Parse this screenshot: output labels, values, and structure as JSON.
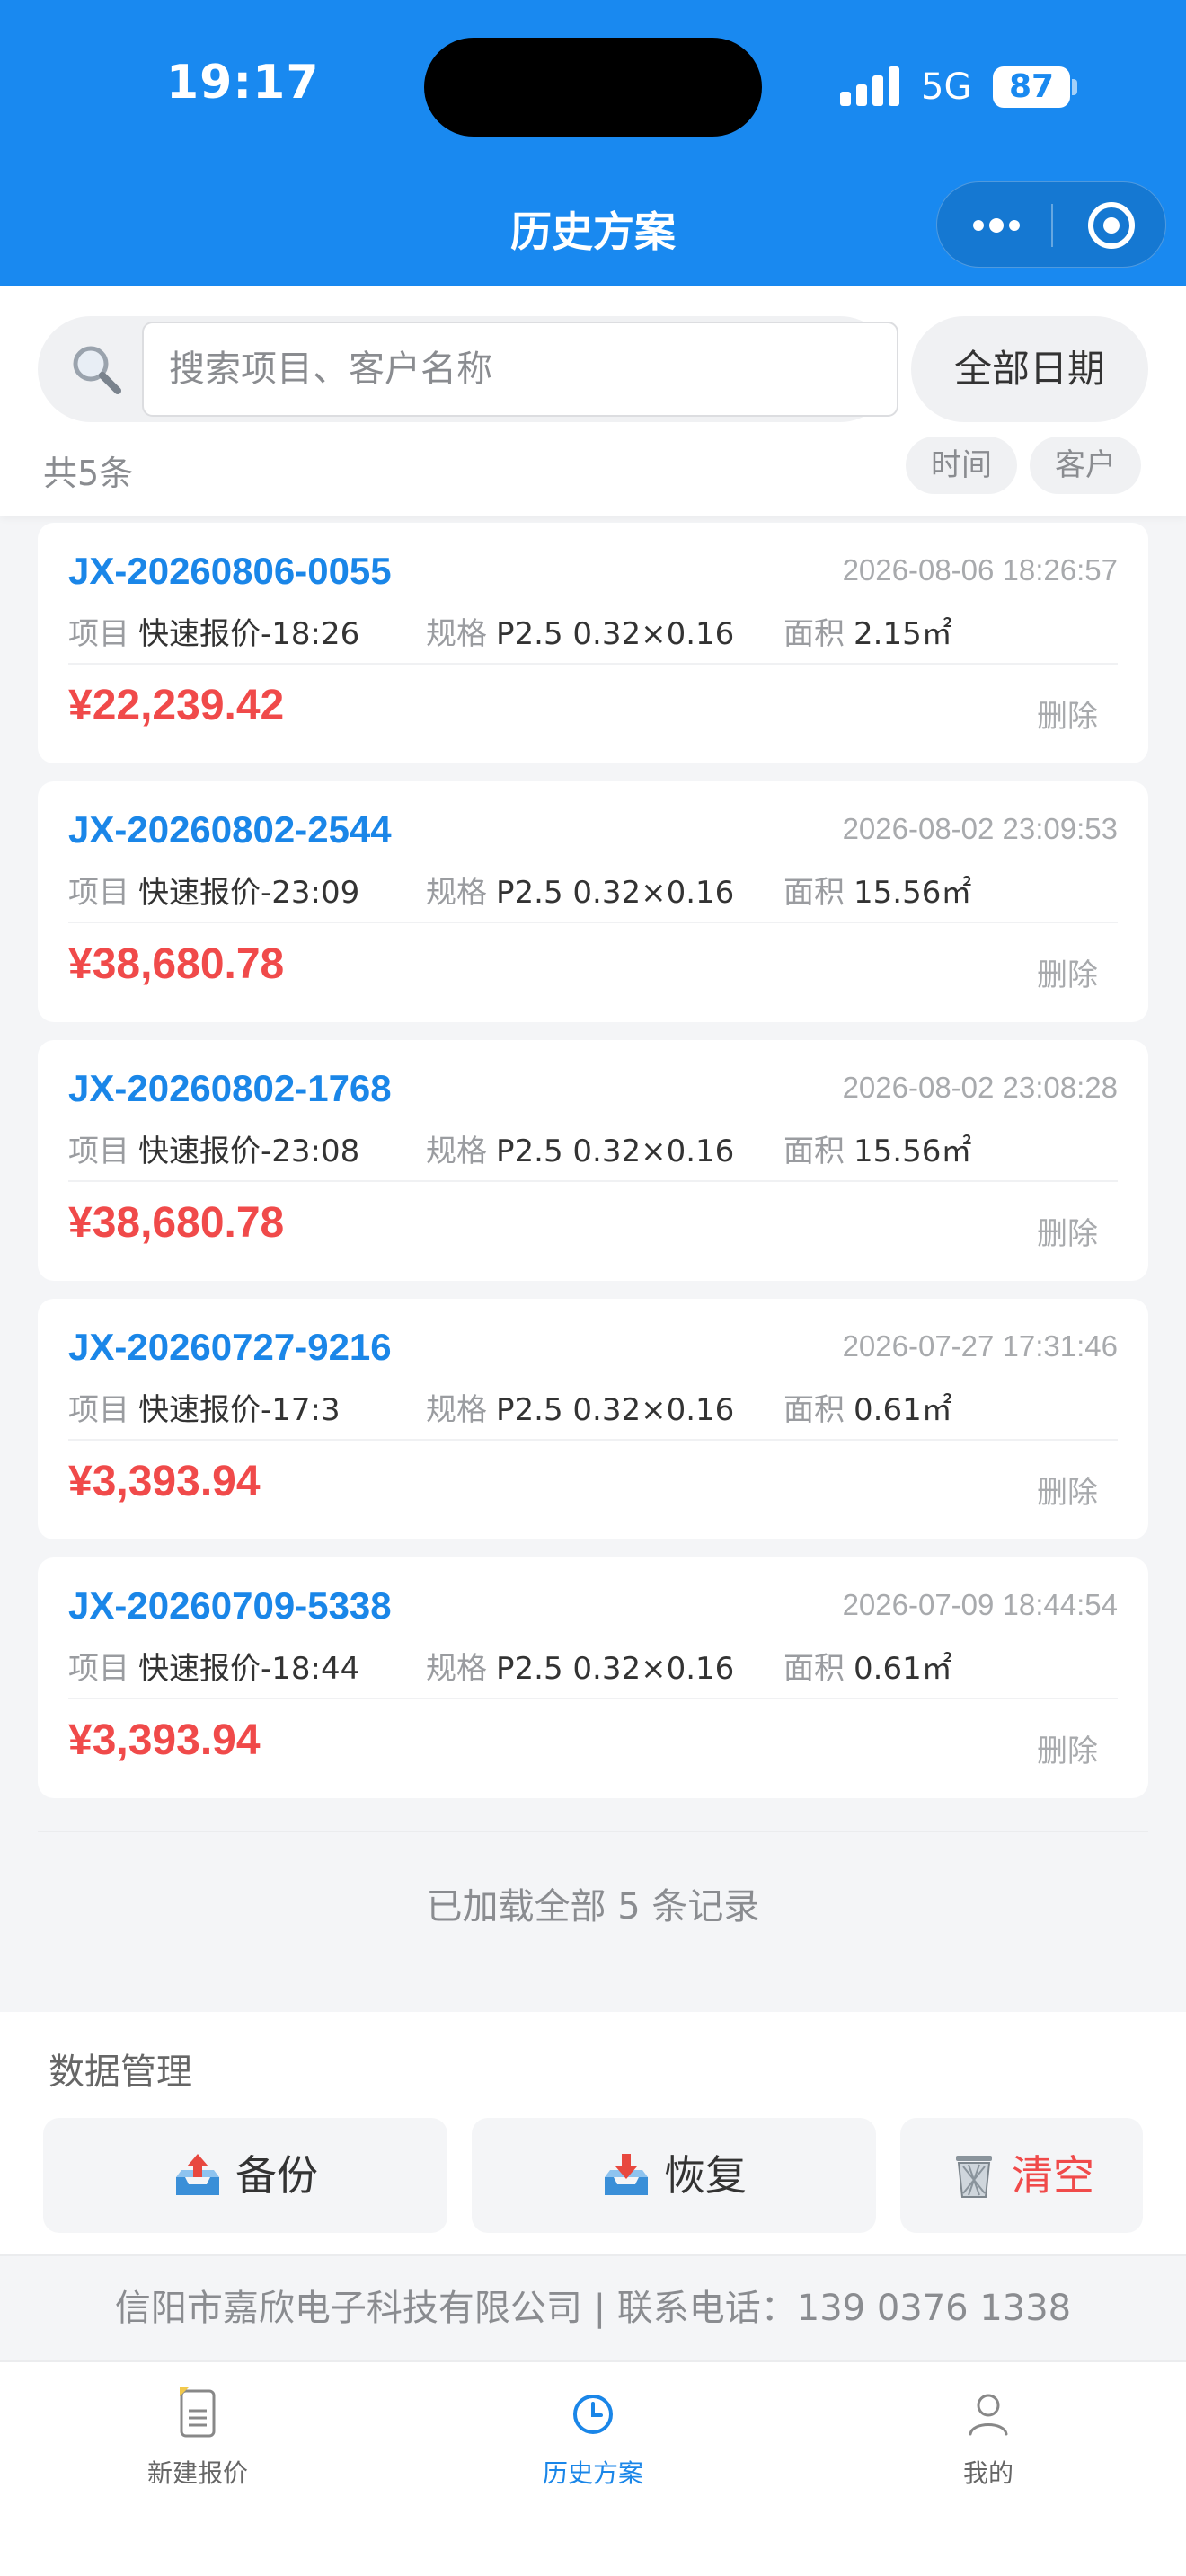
{
  "status_bar": {
    "time": "19:17",
    "network": "5G",
    "battery": "87"
  },
  "nav": {
    "title": "历史方案"
  },
  "search": {
    "placeholder": "搜索项目、客户名称",
    "value": "",
    "date_filter": "全部日期"
  },
  "list_meta": {
    "total": "共5条",
    "sort_time": "时间",
    "sort_customer": "客户"
  },
  "labels": {
    "project": "项目",
    "spec": "规格",
    "area": "面积",
    "delete": "删除"
  },
  "records": [
    {
      "id": "JX-20260806-0055",
      "time": "2026-08-06 18:26:57",
      "project": "快速报价-18:26",
      "spec": "P2.5 0.32×0.16",
      "area": "2.15㎡",
      "price": "¥22,239.42"
    },
    {
      "id": "JX-20260802-2544",
      "time": "2026-08-02 23:09:53",
      "project": "快速报价-23:09",
      "spec": "P2.5 0.32×0.16",
      "area": "15.56㎡",
      "price": "¥38,680.78"
    },
    {
      "id": "JX-20260802-1768",
      "time": "2026-08-02 23:08:28",
      "project": "快速报价-23:08",
      "spec": "P2.5 0.32×0.16",
      "area": "15.56㎡",
      "price": "¥38,680.78"
    },
    {
      "id": "JX-20260727-9216",
      "time": "2026-07-27 17:31:46",
      "project": "快速报价-17:3",
      "spec": "P2.5 0.32×0.16",
      "area": "0.61㎡",
      "price": "¥3,393.94"
    },
    {
      "id": "JX-20260709-5338",
      "time": "2026-07-09 18:44:54",
      "project": "快速报价-18:44",
      "spec": "P2.5 0.32×0.16",
      "area": "0.61㎡",
      "price": "¥3,393.94"
    }
  ],
  "end_note": "已加载全部 5 条记录",
  "data_management": {
    "title": "数据管理",
    "backup": "备份",
    "restore": "恢复",
    "clear": "清空"
  },
  "footer": {
    "company": "信阳市嘉欣电子科技有限公司 | 联系电话：139 0376 1338"
  },
  "tabbar": {
    "new_quote": "新建报价",
    "history": "历史方案",
    "mine": "我的"
  },
  "colors": {
    "primary": "#1989f0",
    "link": "#1a86e8",
    "price": "#f04a4a",
    "muted": "#8a8c90"
  },
  "icons": [
    "search-icon",
    "more-icon",
    "target-icon",
    "backup-icon",
    "restore-icon",
    "trash-icon",
    "document-icon",
    "clock-icon",
    "user-icon"
  ]
}
